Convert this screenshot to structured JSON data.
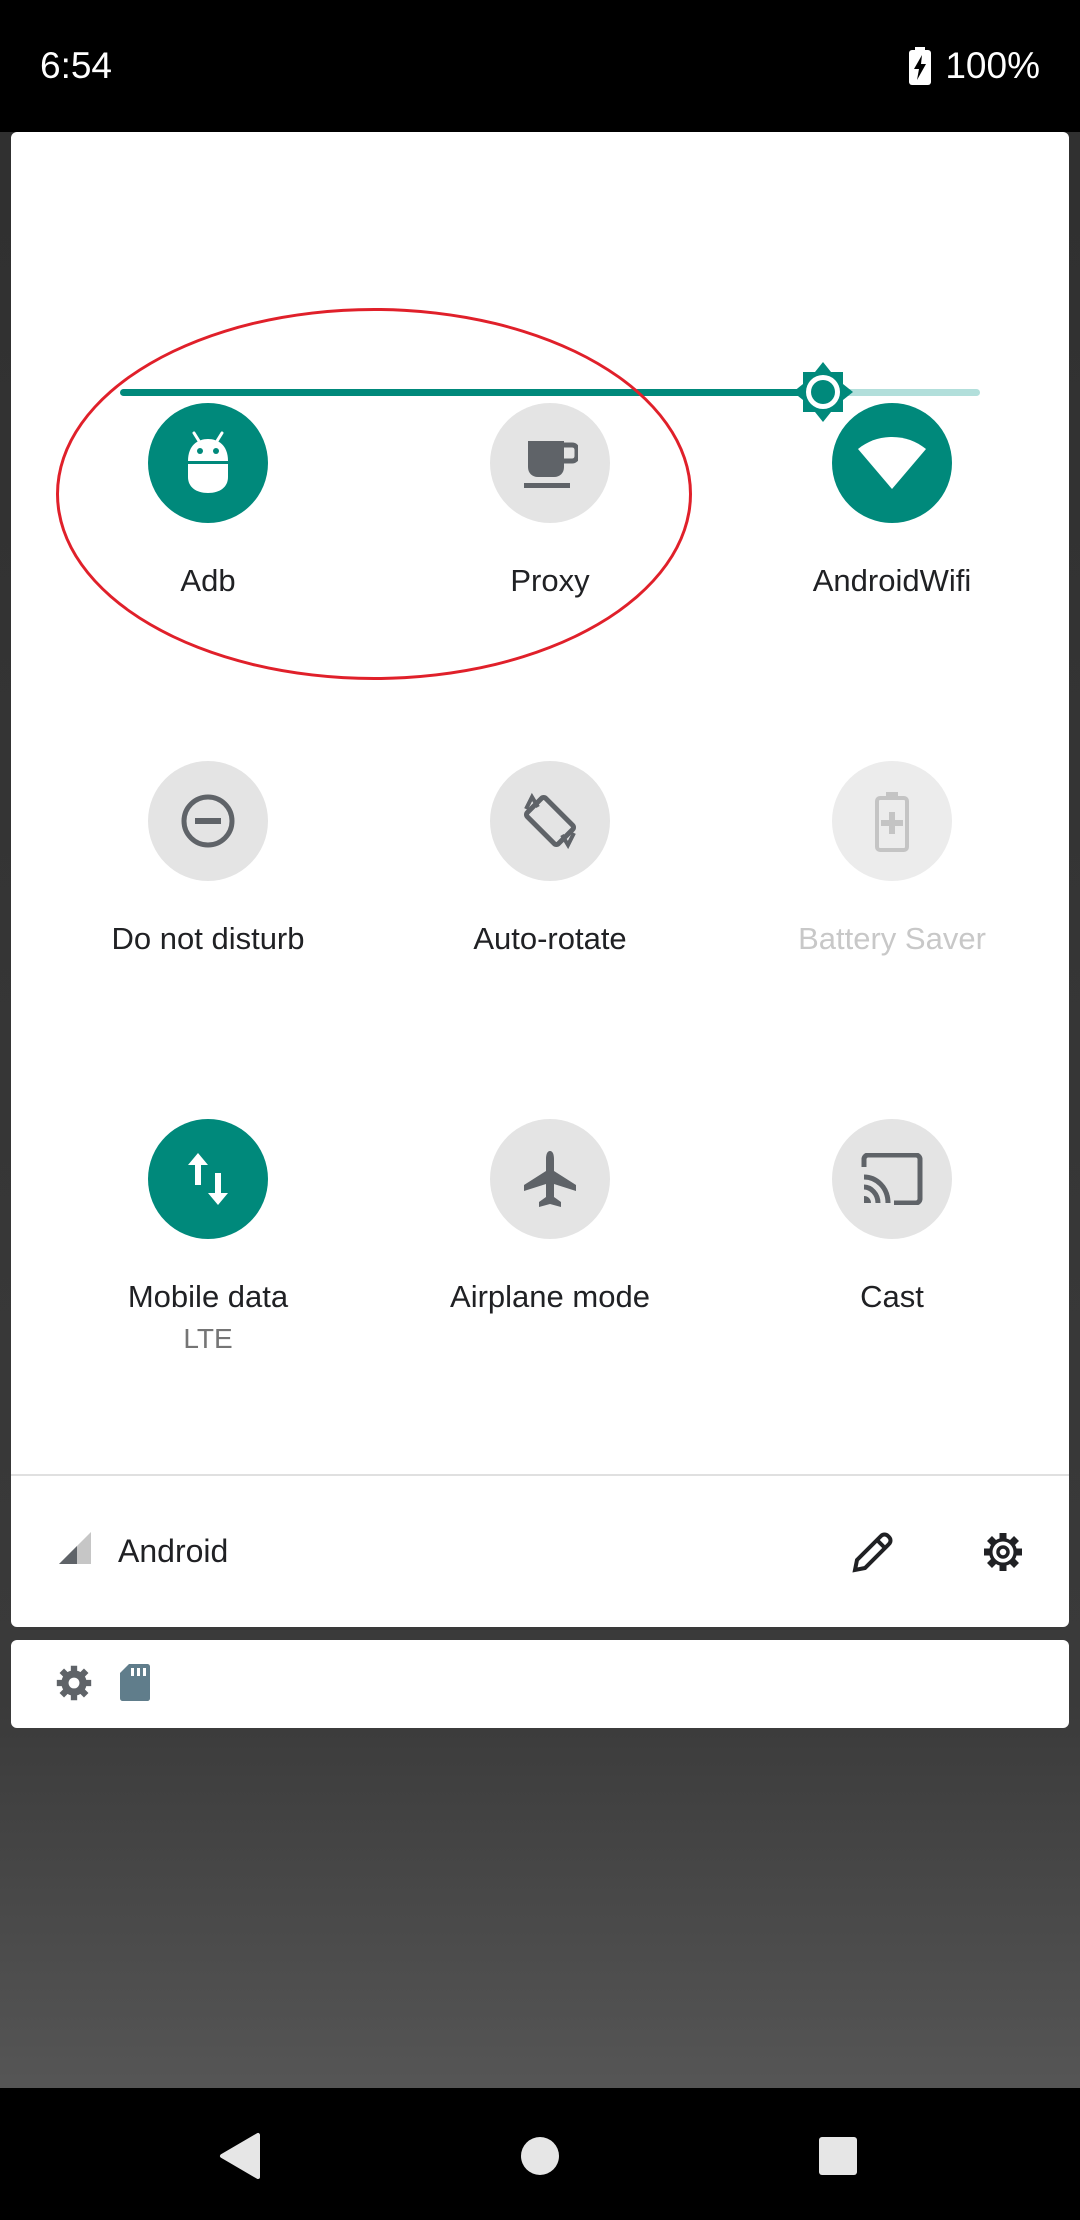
{
  "status_bar": {
    "time": "6:54",
    "battery_percent": "100%",
    "battery_icon": "battery-charging-icon"
  },
  "brightness": {
    "level": 0.82,
    "icon": "brightness-icon",
    "colors": {
      "active": "#00897b",
      "inactive": "#b2dfdb"
    }
  },
  "tiles": [
    {
      "label": "Adb",
      "icon": "android-icon",
      "state": "on"
    },
    {
      "label": "Proxy",
      "icon": "coffee-cup-icon",
      "state": "off"
    },
    {
      "label": "AndroidWifi",
      "icon": "wifi-icon",
      "state": "on"
    },
    {
      "label": "Do not disturb",
      "icon": "do-not-disturb-icon",
      "state": "off"
    },
    {
      "label": "Auto-rotate",
      "icon": "auto-rotate-icon",
      "state": "off"
    },
    {
      "label": "Battery Saver",
      "icon": "battery-saver-icon",
      "state": "disabled"
    },
    {
      "label": "Mobile data",
      "sublabel": "LTE",
      "icon": "mobile-data-icon",
      "state": "on"
    },
    {
      "label": "Airplane mode",
      "icon": "airplane-icon",
      "state": "off"
    },
    {
      "label": "Cast",
      "icon": "cast-icon",
      "state": "off"
    }
  ],
  "footer": {
    "carrier": "Android",
    "signal_icon": "signal-icon",
    "edit_icon": "pencil-icon",
    "settings_icon": "gear-icon"
  },
  "notification_strip": {
    "icons": [
      "gear-icon",
      "sd-card-icon"
    ]
  },
  "nav_bar": {
    "icons": [
      "back-icon",
      "home-icon",
      "recents-icon"
    ]
  },
  "theme": {
    "accent": "#00897b",
    "annotation": "#e0202a"
  }
}
